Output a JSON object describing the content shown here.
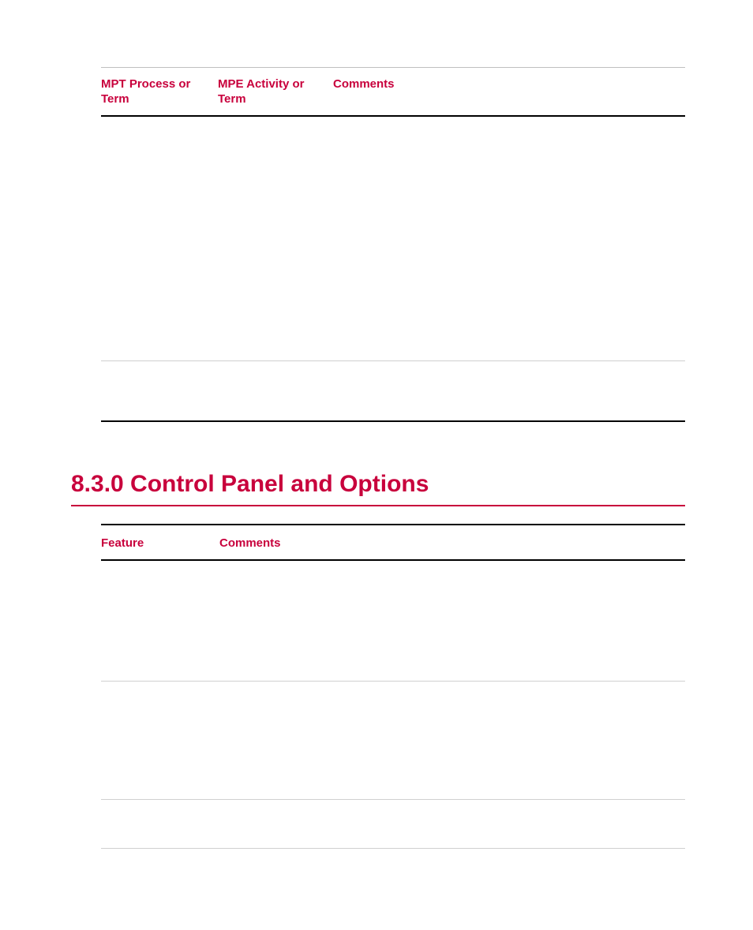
{
  "table1": {
    "headers": {
      "col1": "MPT Process or Term",
      "col2": "MPE Activity or Term",
      "col3": "Comments"
    }
  },
  "section": {
    "title": "8.3.0 Control Panel and Options"
  },
  "table2": {
    "headers": {
      "col1": "Feature",
      "col2": "Comments"
    }
  }
}
